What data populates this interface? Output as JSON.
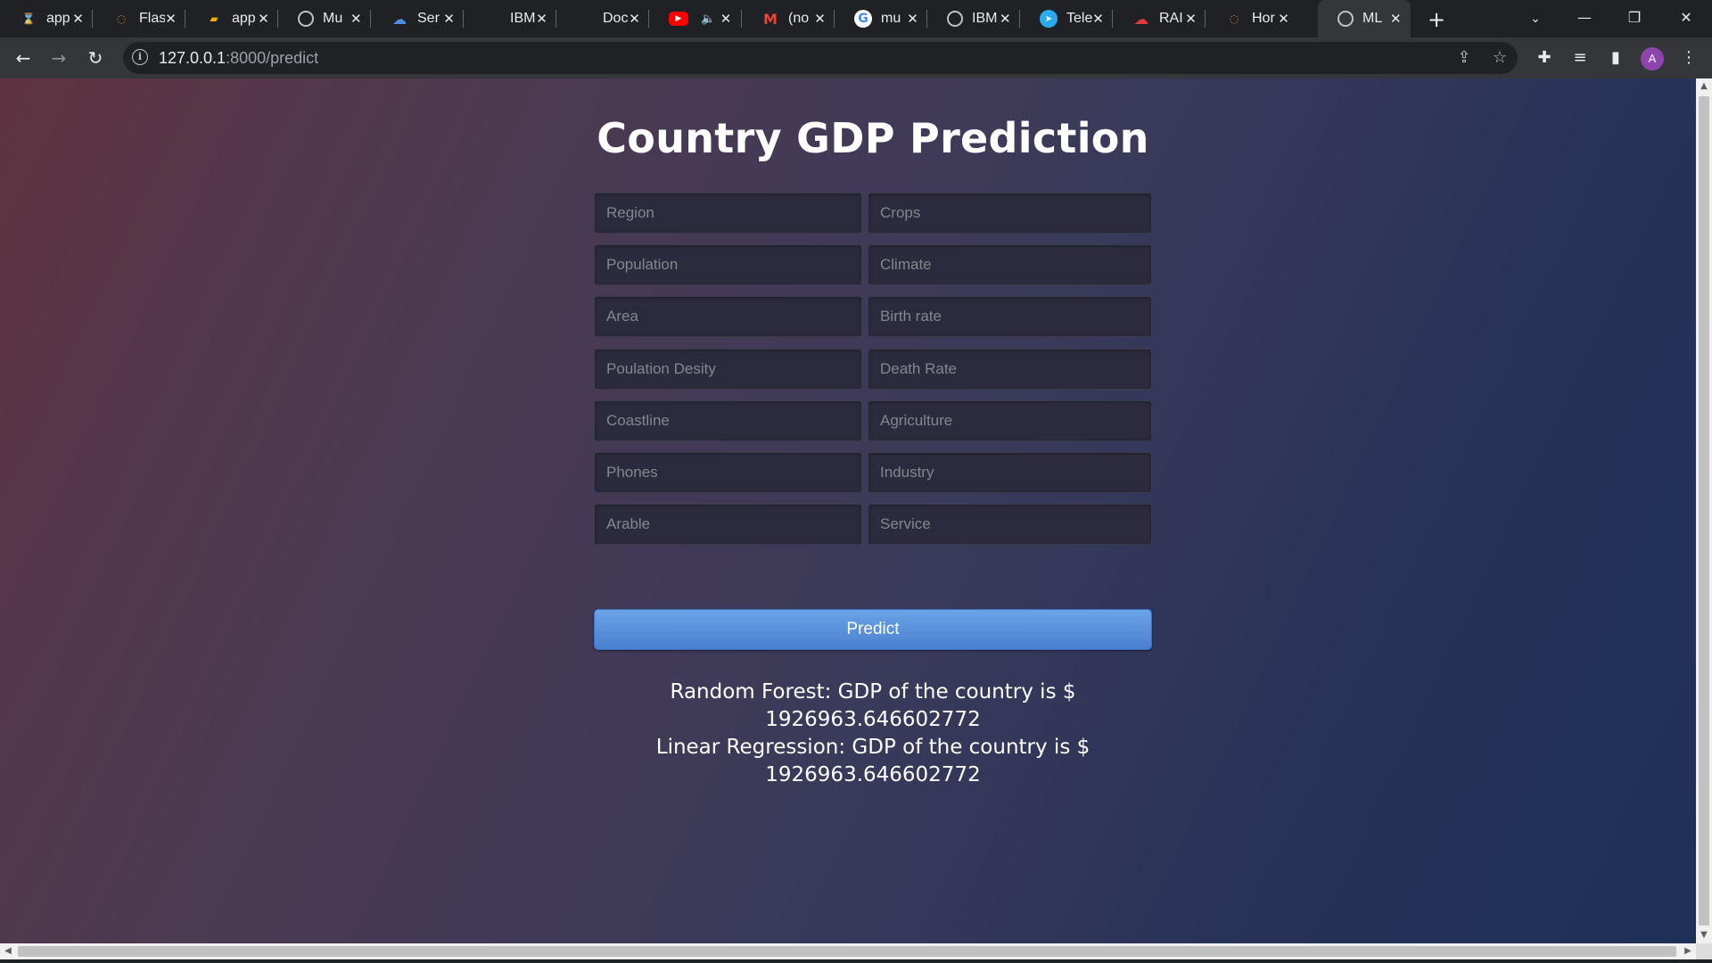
{
  "browser": {
    "tabs": [
      {
        "label": "app",
        "icon": "hourglass-icon",
        "color": "#e37400"
      },
      {
        "label": "Flas",
        "icon": "jupyter-icon",
        "color": "#f37726"
      },
      {
        "label": "app",
        "icon": "notebook-icon",
        "color": "#f9ab00"
      },
      {
        "label": "Mu",
        "icon": "globe-icon",
        "color": "#bdc1c6"
      },
      {
        "label": "Ser",
        "icon": "cloud-icon",
        "color": "#4a90e2"
      },
      {
        "label": "IBM",
        "icon": "blank-icon",
        "color": "#202124"
      },
      {
        "label": "Doc",
        "icon": "blank-icon",
        "color": "#202124"
      },
      {
        "label": "",
        "icon": "youtube-icon",
        "color": "#ff0000"
      },
      {
        "label": "(no",
        "icon": "gmail-icon",
        "color": "#ea4335"
      },
      {
        "label": "mu",
        "icon": "google-icon",
        "color": "#4285f4"
      },
      {
        "label": "IBM",
        "icon": "globe-icon",
        "color": "#bdc1c6"
      },
      {
        "label": "Tele",
        "icon": "telegram-icon",
        "color": "#2aabee"
      },
      {
        "label": "RAI",
        "icon": "cloud-icon",
        "color": "#e53935"
      },
      {
        "label": "Hor",
        "icon": "jupyter-icon",
        "color": "#f37726"
      },
      {
        "label": "ML",
        "icon": "globe-icon",
        "color": "#bdc1c6"
      }
    ],
    "url_host": "127.0.0.1",
    "url_path": ":8000/predict",
    "profile_initial": "A"
  },
  "page": {
    "title": "Country GDP Prediction",
    "fields": [
      {
        "placeholder": "Region"
      },
      {
        "placeholder": "Crops"
      },
      {
        "placeholder": "Population"
      },
      {
        "placeholder": "Climate"
      },
      {
        "placeholder": "Area"
      },
      {
        "placeholder": "Birth rate"
      },
      {
        "placeholder": "Poulation Desity"
      },
      {
        "placeholder": "Death Rate"
      },
      {
        "placeholder": "Coastline"
      },
      {
        "placeholder": "Agriculture"
      },
      {
        "placeholder": "Phones"
      },
      {
        "placeholder": "Industry"
      },
      {
        "placeholder": "Arable"
      },
      {
        "placeholder": "Service"
      }
    ],
    "predict_label": "Predict",
    "result_rf_1": "Random Forest: GDP of the country is $",
    "result_rf_2": "1926963.646602772",
    "result_lr_1": "Linear Regression: GDP of the country is $",
    "result_lr_2": "1926963.646602772"
  }
}
